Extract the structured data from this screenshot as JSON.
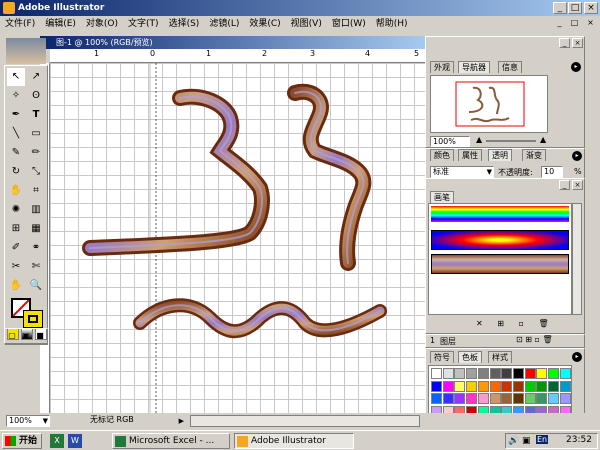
{
  "window": {
    "title": "Adobe Illustrator"
  },
  "menu": [
    "文件(F)",
    "编辑(E)",
    "对象(O)",
    "文字(T)",
    "选择(S)",
    "滤镜(L)",
    "效果(C)",
    "视图(V)",
    "窗口(W)",
    "帮助(H)"
  ],
  "document": {
    "title": "图-1 @ 100% (RGB/预览)"
  },
  "ruler": {
    "marks": [
      "1",
      "0",
      "1",
      "2",
      "3",
      "4",
      "5"
    ]
  },
  "navigator": {
    "tabs": [
      "外观",
      "导航器",
      "信息"
    ],
    "zoom": "100%"
  },
  "transparency": {
    "tabs": [
      "颜色",
      "属性",
      "透明",
      "渐变"
    ],
    "mode": "标准",
    "opacity_label": "不透明度:",
    "opacity": "10",
    "unit": "%"
  },
  "brushes": {
    "title": "画笔"
  },
  "layers": {
    "count": "1",
    "label": "图层"
  },
  "swatches": {
    "tabs": [
      "符号",
      "色板",
      "样式"
    ],
    "colors": [
      "#ffffff",
      "#e0e0e0",
      "#c0c0c0",
      "#a0a0a0",
      "#808080",
      "#606060",
      "#404040",
      "#000000",
      "#ff0000",
      "#ffff00",
      "#00ff00",
      "#00ffff",
      "#0000ff",
      "#ff00ff",
      "#ffff66",
      "#ffcc00",
      "#ff9900",
      "#ff6600",
      "#cc3300",
      "#993300",
      "#00cc00",
      "#009900",
      "#006633",
      "#0099cc",
      "#0066ff",
      "#3333ff",
      "#9933ff",
      "#ff33cc",
      "#ff99cc",
      "#cc9966",
      "#996633",
      "#663300",
      "#66cc66",
      "#339966",
      "#66ccff",
      "#9999ff",
      "#cc99ff",
      "#ffcccc",
      "#ff6666",
      "#cc0000",
      "#00ff99",
      "#00cc99",
      "#33cccc",
      "#3399ff",
      "#6666cc",
      "#9966cc",
      "#cc66cc",
      "#ff66ff"
    ]
  },
  "status": {
    "zoom": "100%",
    "label": "无标记 RGB"
  },
  "taskbar": {
    "start": "开始",
    "excel": "Microsoft Excel - ...",
    "illustrator": "Adobe Illustrator",
    "clock": "23:52",
    "lang": "En"
  }
}
